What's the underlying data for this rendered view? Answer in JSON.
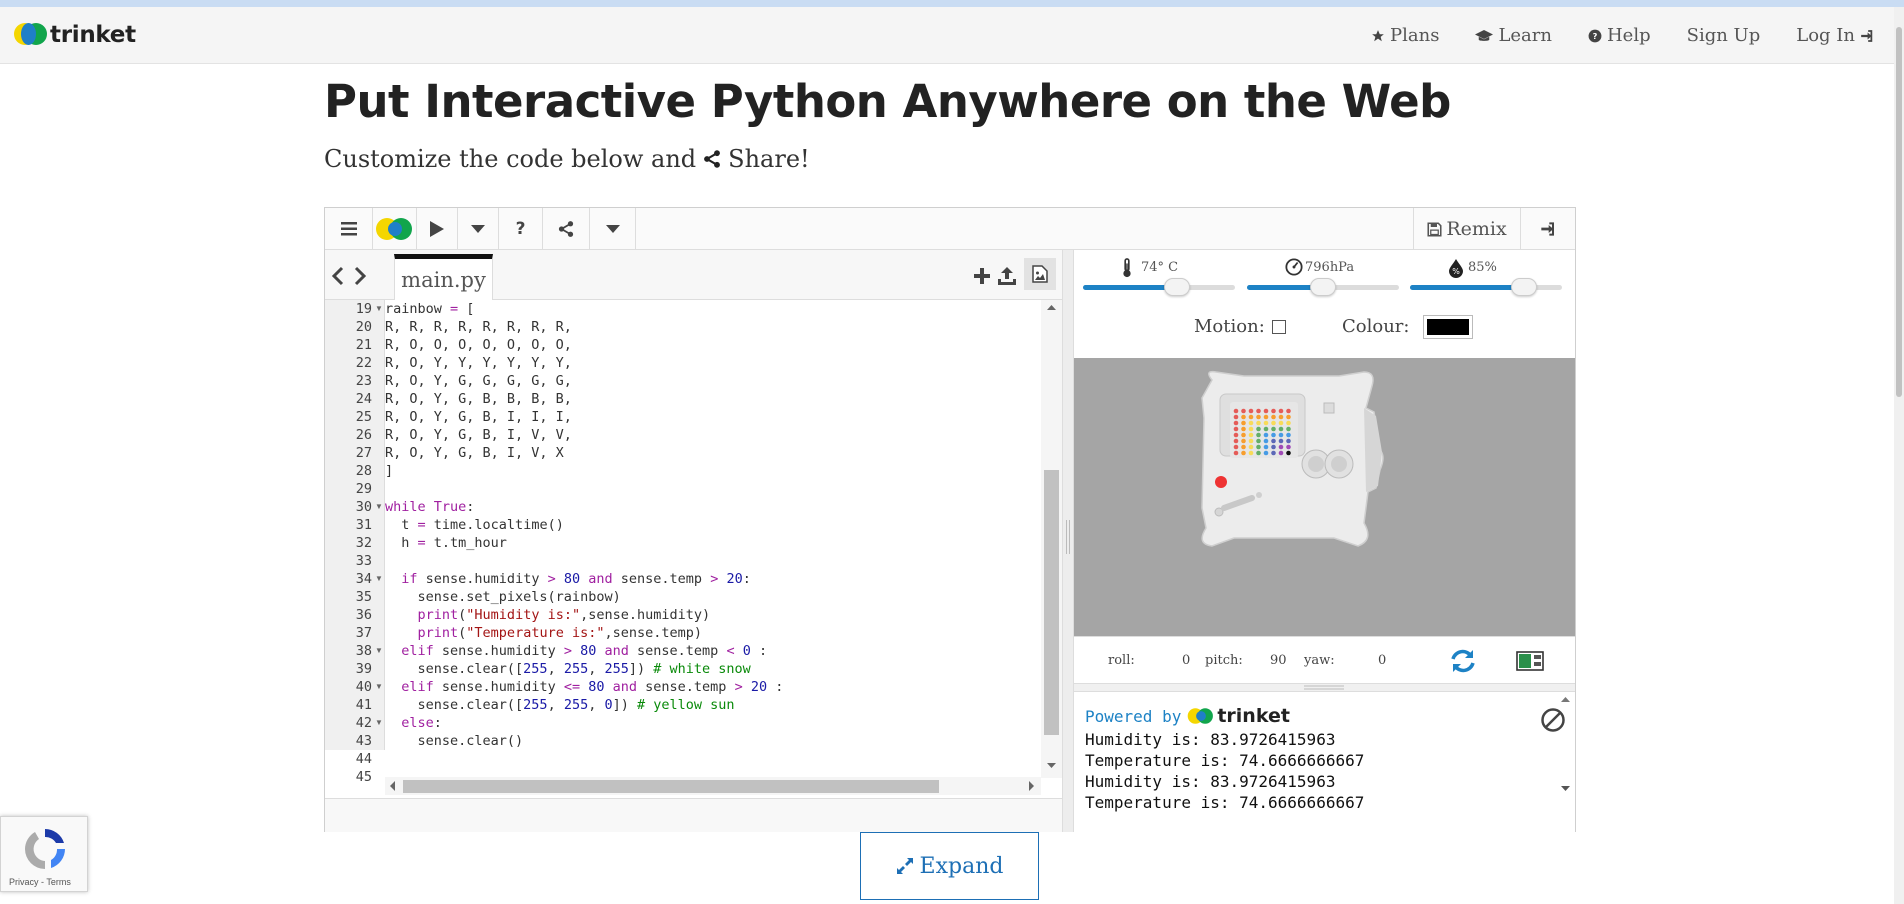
{
  "nav": {
    "brand": "trinket",
    "links": [
      {
        "label": "Plans",
        "icon": "star-icon"
      },
      {
        "label": "Learn",
        "icon": "graduation-cap-icon"
      },
      {
        "label": "Help",
        "icon": "question-circle-icon"
      },
      {
        "label": "Sign Up",
        "icon": ""
      },
      {
        "label": "Log In",
        "icon": "sign-in-icon"
      }
    ]
  },
  "hero": {
    "title": "Put Interactive Python Anywhere on the Web",
    "subtitle_before": "Customize the code below and",
    "subtitle_share": "Share!"
  },
  "toolbar": {
    "remix_label": "Remix"
  },
  "editor": {
    "filename": "main.py",
    "line_numbers": [
      "19",
      "20",
      "21",
      "22",
      "23",
      "24",
      "25",
      "26",
      "27",
      "28",
      "29",
      "30",
      "31",
      "32",
      "33",
      "34",
      "35",
      "36",
      "37",
      "38",
      "39",
      "40",
      "41",
      "42",
      "43",
      "44",
      "45"
    ],
    "lines": [
      "rainbow = [",
      "R, R, R, R, R, R, R, R,",
      "R, O, O, O, O, O, O, O,",
      "R, O, Y, Y, Y, Y, Y, Y,",
      "R, O, Y, G, G, G, G, G,",
      "R, O, Y, G, B, B, B, B,",
      "R, O, Y, G, B, I, I, I,",
      "R, O, Y, G, B, I, V, V,",
      "R, O, Y, G, B, I, V, X",
      "]",
      "",
      "while True:",
      "  t = time.localtime()",
      "  h = t.tm_hour",
      "",
      "  if sense.humidity > 80 and sense.temp > 20:",
      "    sense.set_pixels(rainbow)",
      "    print(\"Humidity is:\",sense.humidity)",
      "    print(\"Temperature is:\",sense.temp)",
      "  elif sense.humidity > 80 and sense.temp < 0 :",
      "    sense.clear([255, 255, 255]) # white snow",
      "  elif sense.humidity <= 80 and sense.temp > 20 :",
      "    sense.clear([255, 255, 0]) # yellow sun",
      "  else:",
      "    sense.clear()",
      "",
      ""
    ]
  },
  "sensors": {
    "temperature": {
      "label": "74° C",
      "level": 0.62
    },
    "pressure": {
      "label": "796hPa",
      "level": 0.5
    },
    "humidity": {
      "label": "85%",
      "level": 0.75
    }
  },
  "controls": {
    "motion_label": "Motion:",
    "motion_checked": false,
    "colour_label": "Colour:",
    "colour_value": "#000000"
  },
  "orientation": {
    "roll_label": "roll:",
    "roll_value": "0",
    "pitch_label": "pitch:",
    "pitch_value": "90",
    "yaw_label": "yaw:",
    "yaw_value": "0"
  },
  "console": {
    "powered_by": "Powered by",
    "brand": "trinket",
    "output": [
      "Humidity is: 83.9726415963",
      "Temperature is: 74.6666666667",
      "Humidity is: 83.9726415963",
      "Temperature is: 74.6666666667"
    ]
  },
  "expand_label": "Expand",
  "recaptcha": {
    "privacy": "Privacy",
    "sep": " - ",
    "terms": "Terms"
  },
  "colors": {
    "accent": "#1d82c5",
    "keyword": "#a020a0",
    "string": "#a31515",
    "comment": "#0a8a0a",
    "number": "#1a1aa6"
  }
}
